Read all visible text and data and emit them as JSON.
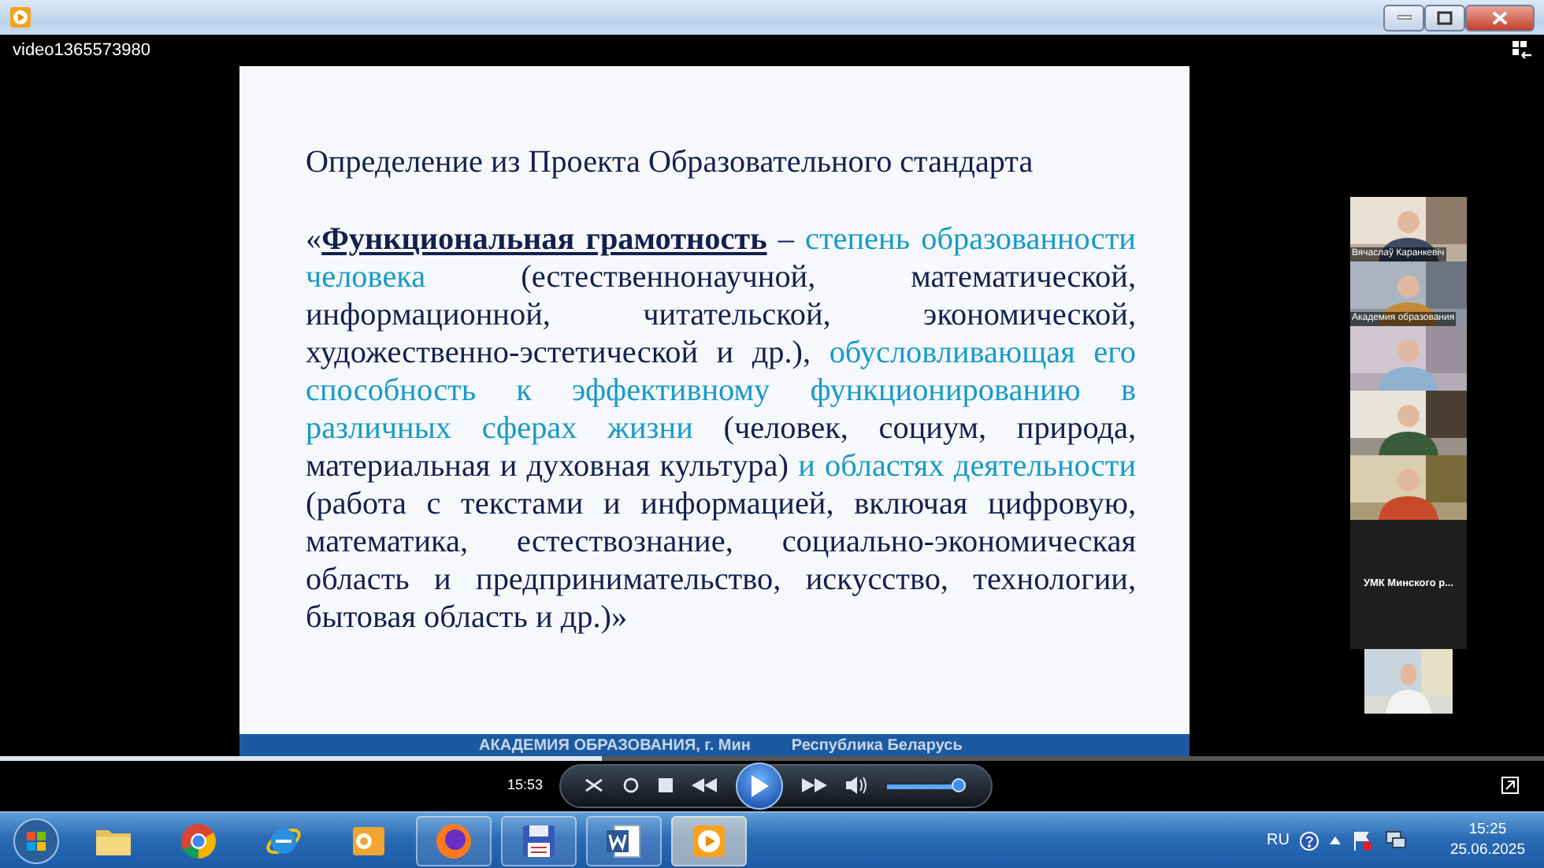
{
  "player": {
    "video_title": "video1365573980",
    "time": "15:53",
    "seek": {
      "level": 0.39
    },
    "volume": {
      "level": 0.9
    }
  },
  "slide": {
    "heading": "Определение из Проекта Образовательного стандарта",
    "paragraph": [
      {
        "kind": "plain",
        "text": "«"
      },
      {
        "kind": "term",
        "text": "Функциональная грамотность"
      },
      {
        "kind": "plain",
        "text": " – "
      },
      {
        "kind": "accent",
        "text": "степень образованности человека"
      },
      {
        "kind": "plain",
        "text": " (естественнонаучной, математической, информационной, читательской, экономической, художественно-эстетической и др.), "
      },
      {
        "kind": "accent",
        "text": "обусловливающая его способность к эффективному функционированию в различных сферах жизни"
      },
      {
        "kind": "plain",
        "text": " (человек, социум, природа, материальная и духовная культура) "
      },
      {
        "kind": "accent",
        "text": "и областях деятельности"
      },
      {
        "kind": "plain",
        "text": " (работа с текстами и информацией, включая цифровую, математика, естествознание, социально-экономическая область и предпринимательство, искусство, технологии, бытовая область и др.)»"
      }
    ],
    "footer_left": "АКАДЕМИЯ ОБРАЗОВАНИЯ,  г. Мин",
    "footer_right": "Республика Беларусь"
  },
  "participants": [
    {
      "kind": "video",
      "name": "Вячаслаў Каранкевіч"
    },
    {
      "kind": "video",
      "name": "Академия образования"
    },
    {
      "kind": "video"
    },
    {
      "kind": "video"
    },
    {
      "kind": "video"
    },
    {
      "kind": "blank",
      "name": "УМК Минского р..."
    },
    {
      "kind": "video"
    }
  ],
  "taskbar": {
    "items": [
      {
        "kind": "folder",
        "running": false,
        "selected": false
      },
      {
        "kind": "chrome",
        "running": false,
        "selected": false
      },
      {
        "kind": "ie",
        "running": false,
        "selected": false
      },
      {
        "kind": "outlook",
        "running": false,
        "selected": false
      },
      {
        "kind": "firefox",
        "running": true,
        "selected": false
      },
      {
        "kind": "disk",
        "running": true,
        "selected": false
      },
      {
        "kind": "word",
        "running": true,
        "selected": false
      },
      {
        "kind": "player",
        "running": true,
        "selected": true
      }
    ],
    "language": "RU",
    "time": "15:25",
    "date": "25.06.2025"
  }
}
